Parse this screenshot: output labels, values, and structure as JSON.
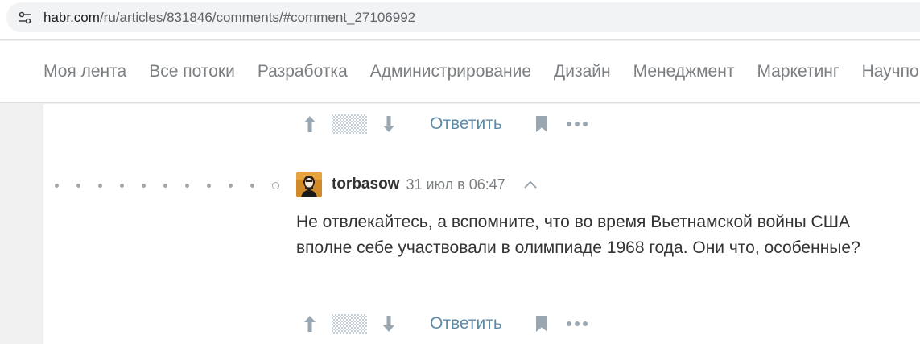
{
  "browser": {
    "url_domain": "habr.com",
    "url_path": "/ru/articles/831846/comments/#comment_27106992",
    "site_icon": "tune-icon"
  },
  "nav": {
    "items": [
      {
        "label": "Моя лента"
      },
      {
        "label": "Все потоки"
      },
      {
        "label": "Разработка"
      },
      {
        "label": "Администрирование"
      },
      {
        "label": "Дизайн"
      },
      {
        "label": "Менеджмент"
      },
      {
        "label": "Маркетинг"
      },
      {
        "label": "Научпоп"
      }
    ]
  },
  "prev_actions": {
    "reply_label": "Ответить"
  },
  "comment": {
    "author": "torbasow",
    "time": "31 июл в 06:47",
    "text": "Не отвлекайтесь, а вспомните, что во время Вьетнамской войны США вполне себе участвовали в олимпиаде 1968 года. Они что, особенные?",
    "reply_label": "Ответить"
  },
  "colors": {
    "accent_link": "#5e8aa6",
    "icon_gray": "#9aa7b0",
    "nav_text": "#7b7f82"
  }
}
